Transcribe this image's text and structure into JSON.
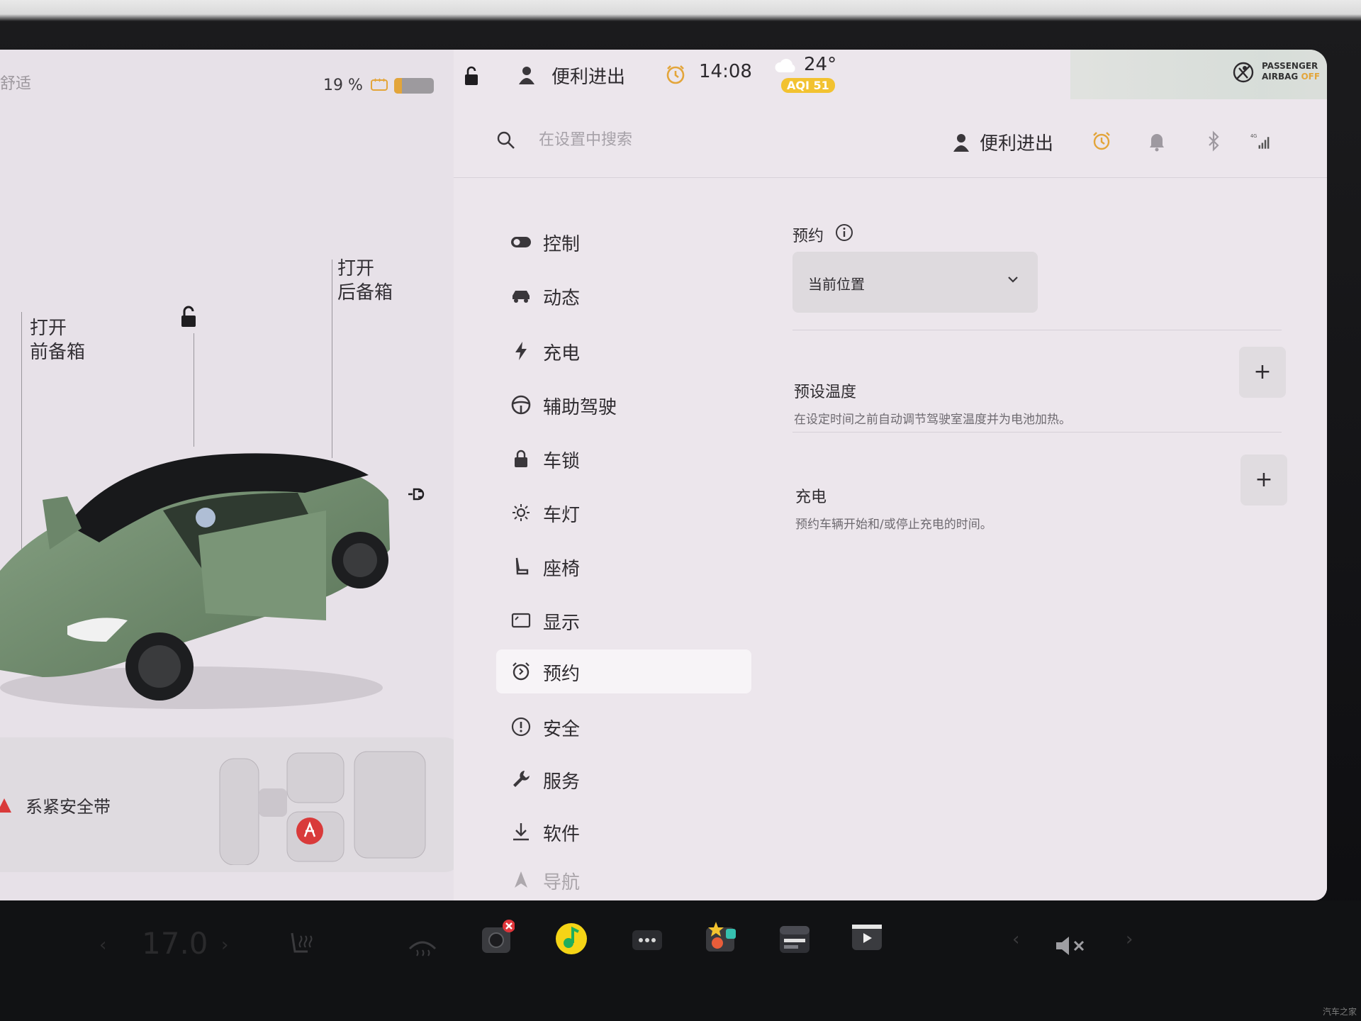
{
  "left_panel": {
    "drive_mode": "舒适",
    "battery_percent": "19 %",
    "battery_level": 0.19,
    "frunk": {
      "line1": "打开",
      "line2": "前备箱"
    },
    "trunk": {
      "line1": "打开",
      "line2": "后备箱"
    },
    "seatbelt_warning": "系紧安全带"
  },
  "top_status": {
    "profile": "便利进出",
    "time": "14:08",
    "temperature": "24°",
    "aqi": "AQI 51",
    "airbag_line1": "PASSENGER",
    "airbag_line2": "AIRBAG",
    "airbag_state": "OFF"
  },
  "settings": {
    "search_placeholder": "在设置中搜索",
    "header_profile": "便利进出",
    "nav": [
      {
        "label": "控制",
        "icon": "toggle-icon"
      },
      {
        "label": "动态",
        "icon": "car-icon"
      },
      {
        "label": "充电",
        "icon": "lightning-icon"
      },
      {
        "label": "辅助驾驶",
        "icon": "steering-wheel-icon"
      },
      {
        "label": "车锁",
        "icon": "lock-icon"
      },
      {
        "label": "车灯",
        "icon": "light-icon"
      },
      {
        "label": "座椅",
        "icon": "seat-icon"
      },
      {
        "label": "显示",
        "icon": "display-icon"
      },
      {
        "label": "预约",
        "icon": "alarm-clock-icon",
        "active": true
      },
      {
        "label": "安全",
        "icon": "alert-circle-icon"
      },
      {
        "label": "服务",
        "icon": "wrench-icon"
      },
      {
        "label": "软件",
        "icon": "download-icon"
      },
      {
        "label": "导航",
        "icon": "navigation-icon"
      }
    ],
    "content": {
      "section_title": "预约",
      "location_value": "当前位置",
      "rows": [
        {
          "title": "预设温度",
          "desc": "在设定时间之前自动调节驾驶室温度并为电池加热。",
          "action": "+"
        },
        {
          "title": "充电",
          "desc": "预约车辆开始和/或停止充电的时间。",
          "action": "+"
        }
      ]
    }
  },
  "dock": {
    "cabin_temp": "17.0"
  },
  "watermark": "汽车之家",
  "colors": {
    "accent_orange": "#e3a53a",
    "aqi_yellow": "#f2c230",
    "screen_bg": "#ece6ec",
    "car_green": "#6f8a6d"
  }
}
